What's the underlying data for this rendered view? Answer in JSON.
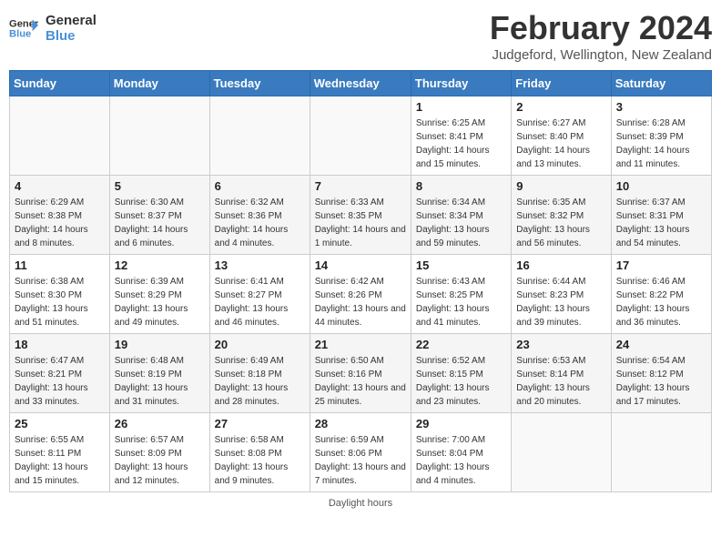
{
  "header": {
    "logo_line1": "General",
    "logo_line2": "Blue",
    "title": "February 2024",
    "subtitle": "Judgeford, Wellington, New Zealand"
  },
  "days_of_week": [
    "Sunday",
    "Monday",
    "Tuesday",
    "Wednesday",
    "Thursday",
    "Friday",
    "Saturday"
  ],
  "weeks": [
    [
      {
        "day": "",
        "info": ""
      },
      {
        "day": "",
        "info": ""
      },
      {
        "day": "",
        "info": ""
      },
      {
        "day": "",
        "info": ""
      },
      {
        "day": "1",
        "info": "Sunrise: 6:25 AM\nSunset: 8:41 PM\nDaylight: 14 hours and 15 minutes."
      },
      {
        "day": "2",
        "info": "Sunrise: 6:27 AM\nSunset: 8:40 PM\nDaylight: 14 hours and 13 minutes."
      },
      {
        "day": "3",
        "info": "Sunrise: 6:28 AM\nSunset: 8:39 PM\nDaylight: 14 hours and 11 minutes."
      }
    ],
    [
      {
        "day": "4",
        "info": "Sunrise: 6:29 AM\nSunset: 8:38 PM\nDaylight: 14 hours and 8 minutes."
      },
      {
        "day": "5",
        "info": "Sunrise: 6:30 AM\nSunset: 8:37 PM\nDaylight: 14 hours and 6 minutes."
      },
      {
        "day": "6",
        "info": "Sunrise: 6:32 AM\nSunset: 8:36 PM\nDaylight: 14 hours and 4 minutes."
      },
      {
        "day": "7",
        "info": "Sunrise: 6:33 AM\nSunset: 8:35 PM\nDaylight: 14 hours and 1 minute."
      },
      {
        "day": "8",
        "info": "Sunrise: 6:34 AM\nSunset: 8:34 PM\nDaylight: 13 hours and 59 minutes."
      },
      {
        "day": "9",
        "info": "Sunrise: 6:35 AM\nSunset: 8:32 PM\nDaylight: 13 hours and 56 minutes."
      },
      {
        "day": "10",
        "info": "Sunrise: 6:37 AM\nSunset: 8:31 PM\nDaylight: 13 hours and 54 minutes."
      }
    ],
    [
      {
        "day": "11",
        "info": "Sunrise: 6:38 AM\nSunset: 8:30 PM\nDaylight: 13 hours and 51 minutes."
      },
      {
        "day": "12",
        "info": "Sunrise: 6:39 AM\nSunset: 8:29 PM\nDaylight: 13 hours and 49 minutes."
      },
      {
        "day": "13",
        "info": "Sunrise: 6:41 AM\nSunset: 8:27 PM\nDaylight: 13 hours and 46 minutes."
      },
      {
        "day": "14",
        "info": "Sunrise: 6:42 AM\nSunset: 8:26 PM\nDaylight: 13 hours and 44 minutes."
      },
      {
        "day": "15",
        "info": "Sunrise: 6:43 AM\nSunset: 8:25 PM\nDaylight: 13 hours and 41 minutes."
      },
      {
        "day": "16",
        "info": "Sunrise: 6:44 AM\nSunset: 8:23 PM\nDaylight: 13 hours and 39 minutes."
      },
      {
        "day": "17",
        "info": "Sunrise: 6:46 AM\nSunset: 8:22 PM\nDaylight: 13 hours and 36 minutes."
      }
    ],
    [
      {
        "day": "18",
        "info": "Sunrise: 6:47 AM\nSunset: 8:21 PM\nDaylight: 13 hours and 33 minutes."
      },
      {
        "day": "19",
        "info": "Sunrise: 6:48 AM\nSunset: 8:19 PM\nDaylight: 13 hours and 31 minutes."
      },
      {
        "day": "20",
        "info": "Sunrise: 6:49 AM\nSunset: 8:18 PM\nDaylight: 13 hours and 28 minutes."
      },
      {
        "day": "21",
        "info": "Sunrise: 6:50 AM\nSunset: 8:16 PM\nDaylight: 13 hours and 25 minutes."
      },
      {
        "day": "22",
        "info": "Sunrise: 6:52 AM\nSunset: 8:15 PM\nDaylight: 13 hours and 23 minutes."
      },
      {
        "day": "23",
        "info": "Sunrise: 6:53 AM\nSunset: 8:14 PM\nDaylight: 13 hours and 20 minutes."
      },
      {
        "day": "24",
        "info": "Sunrise: 6:54 AM\nSunset: 8:12 PM\nDaylight: 13 hours and 17 minutes."
      }
    ],
    [
      {
        "day": "25",
        "info": "Sunrise: 6:55 AM\nSunset: 8:11 PM\nDaylight: 13 hours and 15 minutes."
      },
      {
        "day": "26",
        "info": "Sunrise: 6:57 AM\nSunset: 8:09 PM\nDaylight: 13 hours and 12 minutes."
      },
      {
        "day": "27",
        "info": "Sunrise: 6:58 AM\nSunset: 8:08 PM\nDaylight: 13 hours and 9 minutes."
      },
      {
        "day": "28",
        "info": "Sunrise: 6:59 AM\nSunset: 8:06 PM\nDaylight: 13 hours and 7 minutes."
      },
      {
        "day": "29",
        "info": "Sunrise: 7:00 AM\nSunset: 8:04 PM\nDaylight: 13 hours and 4 minutes."
      },
      {
        "day": "",
        "info": ""
      },
      {
        "day": "",
        "info": ""
      }
    ]
  ],
  "footer": {
    "daylight_label": "Daylight hours"
  }
}
